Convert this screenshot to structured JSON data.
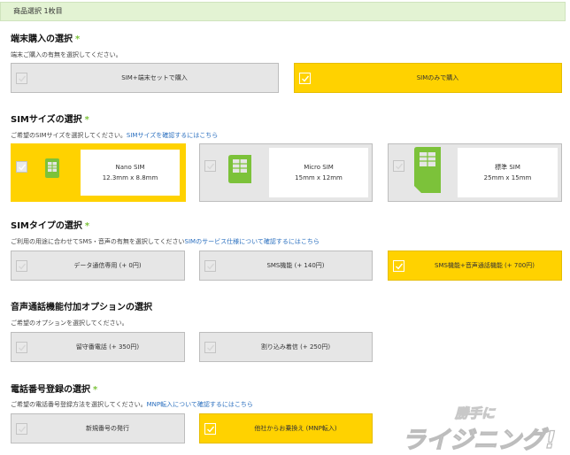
{
  "header": {
    "label": "商品選択 1枚目"
  },
  "device": {
    "title": "端末購入の選択",
    "required_mark": "*",
    "desc": "端末ご購入の有無を選択してください。",
    "options": [
      {
        "label": "SIM+端末セットで購入",
        "selected": false
      },
      {
        "label": "SIMのみで購入",
        "selected": true
      }
    ]
  },
  "sim_size": {
    "title": "SIMサイズの選択",
    "required_mark": "*",
    "desc": "ご希望のSIMサイズを選択してください。",
    "link": "SIMサイズを確認するにはこちら",
    "options": [
      {
        "name": "Nano SIM",
        "size": "12.3mm x 8.8mm",
        "selected": true
      },
      {
        "name": "Micro SIM",
        "size": "15mm x 12mm",
        "selected": false
      },
      {
        "name": "標準 SIM",
        "size": "25mm x 15mm",
        "selected": false
      }
    ]
  },
  "sim_type": {
    "title": "SIMタイプの選択",
    "required_mark": "*",
    "desc": "ご利用の用途に合わせてSMS・音声の有無を選択してください",
    "link": "SIMのサービス仕様について確認するにはこちら",
    "options": [
      {
        "label": "データ通信専用 (+ 0円)",
        "selected": false
      },
      {
        "label": "SMS機能 (+ 140円)",
        "selected": false
      },
      {
        "label": "SMS機能+音声通話機能 (+ 700円)",
        "selected": true
      }
    ]
  },
  "voice_options": {
    "title": "音声通話機能付加オプションの選択",
    "desc": "ご希望のオプションを選択してください。",
    "options": [
      {
        "label": "留守番電話 (+ 350円)",
        "selected": false
      },
      {
        "label": "割り込み着信 (+ 250円)",
        "selected": false
      }
    ]
  },
  "phone_number": {
    "title": "電話番号登録の選択",
    "required_mark": "*",
    "desc": "ご希望の電話番号登録方法を選択してください。",
    "link": "MNP転入について確認するにはこちら",
    "options": [
      {
        "label": "新規番号の発行",
        "selected": false
      },
      {
        "label": "他社からお乗換え (MNP転入)",
        "selected": true
      }
    ]
  },
  "watermark": {
    "top": "勝手に",
    "bottom": "ライジニング!"
  },
  "colors": {
    "selected": "#ffd200",
    "unselected": "#e6e6e6",
    "sim_green": "#7cc23a",
    "link": "#2a6fbf",
    "header_bg": "#e3f3d3"
  }
}
